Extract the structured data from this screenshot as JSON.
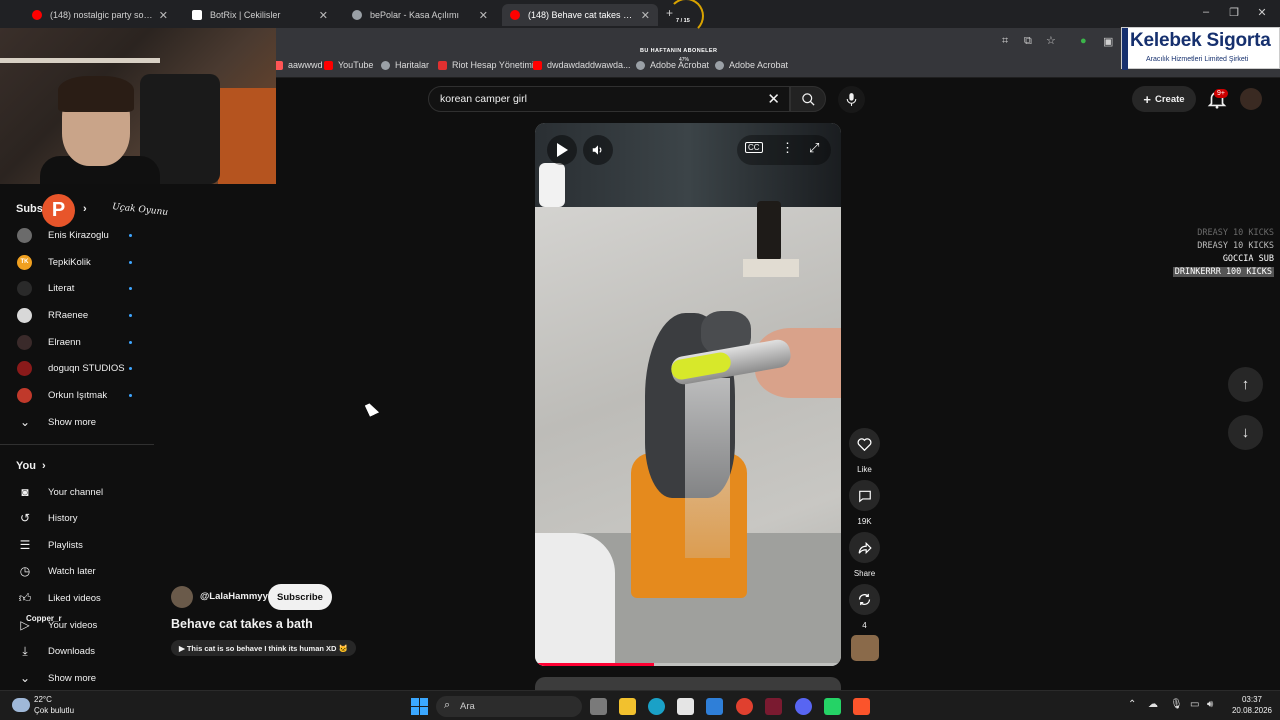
{
  "tabs": [
    {
      "label": "(148) nostalgic party songs – cl",
      "color": "#ff0000"
    },
    {
      "label": "BotRix | Cekilisler",
      "color": "#ffffff"
    },
    {
      "label": "bePolar - Kasa Açılımı",
      "color": "#9aa0a6"
    },
    {
      "label": "(148) Behave cat takes a bath",
      "color": "#ff0000"
    }
  ],
  "new_tab": "+",
  "bookmarks": [
    {
      "label": "aawwwd",
      "color": "#ff5555"
    },
    {
      "label": "YouTube",
      "color": "#ff0000"
    },
    {
      "label": "Haritalar",
      "color": "#9aa0a6"
    },
    {
      "label": "Riot Hesap Yönetimi",
      "color": "#e03030"
    },
    {
      "label": "dwdawdaddwawda...",
      "color": "#ff0000"
    },
    {
      "label": "Adobe Acrobat",
      "color": "#9aa0a6"
    },
    {
      "label": "Adobe Acrobat",
      "color": "#9aa0a6"
    }
  ],
  "overlay": {
    "abone_title": "BU HAFTANIN ABONELER",
    "abone_count": "7 / 15",
    "abone_pct": "47%",
    "logo_title": "Kelebek Sigorta",
    "logo_sub": "Aracılık Hizmetleri Limited Şirketi",
    "kicks": [
      {
        "text": "DREASY 10 KICKS",
        "color": "#6a6a6a"
      },
      {
        "text": "DREASY 10 KICKS",
        "color": "#bdbdbd"
      },
      {
        "text": "GOCCIA SUB",
        "color": "#ffffff"
      },
      {
        "text": "DRINKERRR 100 KICKS",
        "color": "#ffffff"
      }
    ],
    "p_badge": "P",
    "ucak_text": "Uçak Oyunu",
    "copper_text": "Copper_r"
  },
  "search": {
    "query": "korean camper girl"
  },
  "header": {
    "create_label": "Create",
    "notif_badge": "9+"
  },
  "sidebar": {
    "subs_heading": "Subscriptions",
    "subs_heading_visible": "Subs",
    "subs_heading_tail": "s",
    "subscriptions": [
      {
        "label": "Enis Kirazoglu",
        "color": "#6b6b6b",
        "initial": ""
      },
      {
        "label": "TepkiKolik",
        "color": "#f0a020",
        "initial": "TK"
      },
      {
        "label": "Literat",
        "color": "#2a2a2a",
        "initial": ""
      },
      {
        "label": "RRaenee",
        "color": "#d8d8d8",
        "initial": ""
      },
      {
        "label": "Elraenn",
        "color": "#3a2a2a",
        "initial": ""
      },
      {
        "label": "doguqn STUDIOS",
        "color": "#8a1a1a",
        "initial": ""
      },
      {
        "label": "Orkun Işıtmak",
        "color": "#c0392b",
        "initial": ""
      }
    ],
    "show_more": "Show more",
    "you_heading": "You",
    "you_items": [
      {
        "label": "Your channel",
        "icon": "channel-icon"
      },
      {
        "label": "History",
        "icon": "history-icon"
      },
      {
        "label": "Playlists",
        "icon": "playlist-icon"
      },
      {
        "label": "Watch later",
        "icon": "watch-later-icon"
      },
      {
        "label": "Liked videos",
        "icon": "thumbs-up-icon"
      },
      {
        "label": "Your videos",
        "icon": "video-icon"
      },
      {
        "label": "Downloads",
        "icon": "download-icon"
      },
      {
        "label": "Show more",
        "icon": "chevron-down-icon"
      }
    ]
  },
  "short": {
    "channel": "@LalaHammyy",
    "subscribe_label": "Subscribe",
    "title": "Behave cat takes a bath",
    "description": "▶ This cat is so behave I think its human XD 🐱",
    "progress": 0.39,
    "actions": [
      {
        "label": "Like",
        "icon": "heart-icon"
      },
      {
        "label": "19K",
        "icon": "comment-icon"
      },
      {
        "label": "Share",
        "icon": "share-icon"
      },
      {
        "label": "4",
        "icon": "remix-icon"
      }
    ]
  },
  "taskbar": {
    "weather_temp": "22°C",
    "weather_desc": "Çok bulutlu",
    "search_label": "Ara",
    "time": "03:37",
    "date": "20.08.2026",
    "apps": [
      {
        "name": "files-app",
        "color": "#7a7a7a"
      },
      {
        "name": "explorer-app",
        "color": "#f2c12e"
      },
      {
        "name": "edge-app",
        "color": "#1aa1c7"
      },
      {
        "name": "store-app",
        "color": "#e5e5e5"
      },
      {
        "name": "mail-app",
        "color": "#2f7fd8"
      },
      {
        "name": "chrome-app",
        "color": "#e0402f"
      },
      {
        "name": "obs-app",
        "color": "#7a1a30"
      },
      {
        "name": "discord-app",
        "color": "#5865f2"
      },
      {
        "name": "whatsapp-app",
        "color": "#25d366"
      },
      {
        "name": "brave-app",
        "color": "#fb542b"
      }
    ]
  }
}
